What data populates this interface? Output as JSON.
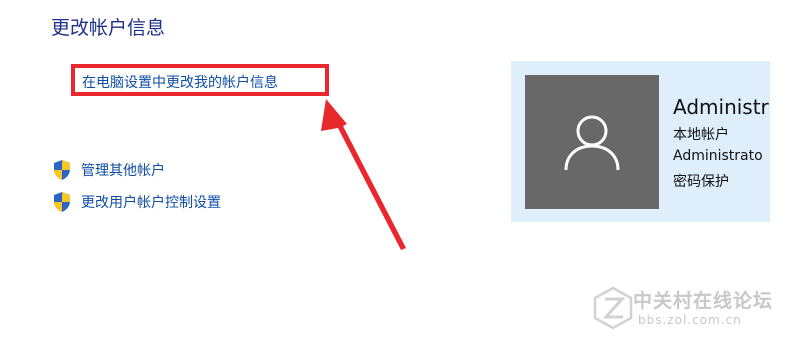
{
  "section": {
    "title": "更改帐户信息"
  },
  "links": {
    "change_account_info_in_pc_settings": "在电脑设置中更改我的帐户信息"
  },
  "tasks": [
    {
      "icon": "uac-shield-icon",
      "label": "管理其他帐户"
    },
    {
      "icon": "uac-shield-icon",
      "label": "更改用户帐户控制设置"
    }
  ],
  "account": {
    "name": "Administr",
    "type": "本地帐户",
    "id": "Administrato",
    "password_status": "密码保护",
    "avatar_icon": "user-icon"
  },
  "watermark": {
    "title": "中关村在线论坛",
    "url": "bbs.zol.com.cn"
  },
  "colors": {
    "title": "#1e3287",
    "link": "#0f4ea3",
    "annotation": "#e8282c",
    "card_background": "#dfeefb",
    "avatar_background": "#686868"
  }
}
